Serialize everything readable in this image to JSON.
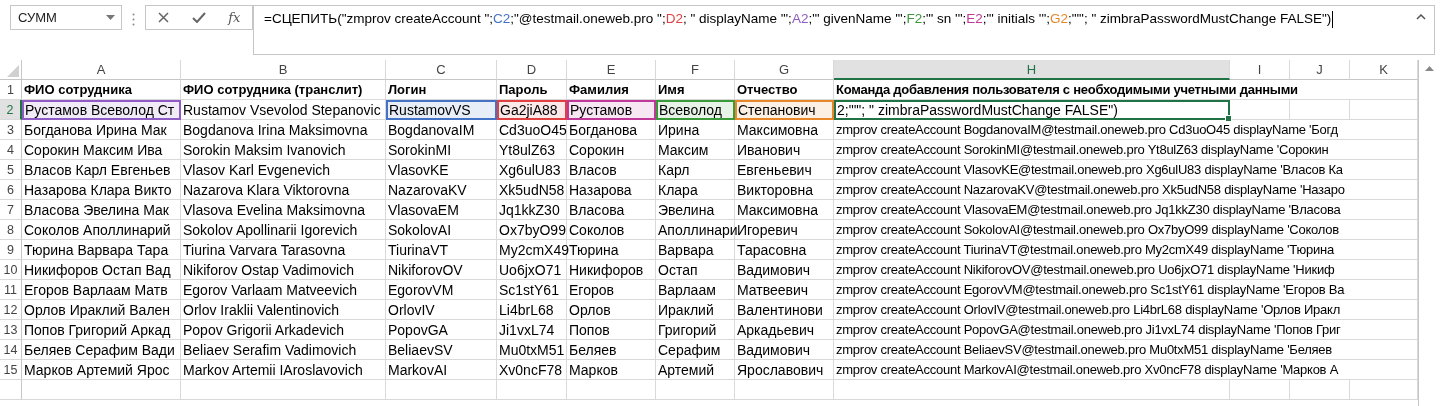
{
  "name_box": {
    "value": "СУММ"
  },
  "formula_bar": {
    "function_label": "fx",
    "segments": [
      {
        "text": "=СЦЕПИТЬ(\"zmprov createAccount \";",
        "color": "#000000"
      },
      {
        "text": "C2",
        "color": "#4472c4"
      },
      {
        "text": ";\"@testmail.oneweb.pro \";",
        "color": "#000000"
      },
      {
        "text": "D2",
        "color": "#e04040"
      },
      {
        "text": "; \" displayName '\";",
        "color": "#000000"
      },
      {
        "text": "A2",
        "color": "#8e5cc4"
      },
      {
        "text": ";\"' givenName '\";",
        "color": "#000000"
      },
      {
        "text": "F2",
        "color": "#3a9a3a"
      },
      {
        "text": ";\"' sn '\";",
        "color": "#000000"
      },
      {
        "text": "E2",
        "color": "#c0399a"
      },
      {
        "text": ";\"' initials '\";",
        "color": "#000000"
      },
      {
        "text": "G2",
        "color": "#e8862a"
      },
      {
        "text": ";\"'\"; \" zimbraPasswordMustChange FALSE\")",
        "color": "#000000"
      }
    ]
  },
  "columns": [
    {
      "letter": "A",
      "selected": false
    },
    {
      "letter": "B",
      "selected": false
    },
    {
      "letter": "C",
      "selected": false
    },
    {
      "letter": "D",
      "selected": false
    },
    {
      "letter": "E",
      "selected": false
    },
    {
      "letter": "F",
      "selected": false
    },
    {
      "letter": "G",
      "selected": false
    },
    {
      "letter": "H",
      "selected": true
    },
    {
      "letter": "I",
      "selected": false
    },
    {
      "letter": "J",
      "selected": false
    },
    {
      "letter": "K",
      "selected": false
    }
  ],
  "rows": [
    {
      "number": "1",
      "selected": false,
      "kind": "header",
      "cells": [
        "ФИО сотрудника",
        "ФИО сотрудника (транслит)",
        "Логин",
        "Пароль",
        "Фамилия",
        "Имя",
        "Отчество",
        "Команда добавления пользователя с необходимыми учетными данными"
      ]
    },
    {
      "number": "2",
      "selected": true,
      "kind": "edit",
      "cells": [
        {
          "text": "Рустамов Всеволод Ст",
          "color": "#8e5cc4",
          "active": false
        },
        {
          "text": "Rustamov Vsevolod Stepanovic",
          "active": false
        },
        {
          "text": "RustamovVS",
          "color": "#4472c4",
          "active": false
        },
        {
          "text": "Ga2jiA88",
          "color": "#e04040",
          "active": false
        },
        {
          "text": "Рустамов",
          "color": "#c0399a",
          "active": false
        },
        {
          "text": "Всеволод",
          "color": "#3a9a3a",
          "active": false
        },
        {
          "text": "Степанович",
          "color": "#e8862a",
          "active": false
        },
        {
          "text": "2;\"'\"; \" zimbraPasswordMustChange FALSE\")",
          "active": true
        }
      ]
    },
    {
      "number": "3",
      "selected": false,
      "kind": "data",
      "cells": [
        "Богданова Ирина Мак",
        "Bogdanova Irina Maksimovna",
        "BogdanovaIM",
        "Cd3uoO45",
        "Богданова",
        "Ирина",
        "Максимовна",
        "zmprov createAccount BogdanovaIM@testmail.oneweb.pro Cd3uoO45 displayName 'Богд"
      ]
    },
    {
      "number": "4",
      "selected": false,
      "kind": "data",
      "cells": [
        "Сорокин Максим Ива",
        "Sorokin Maksim Ivanovich",
        "SorokinMI",
        "Yt8ulZ63",
        "Сорокин",
        "Максим",
        "Иванович",
        "zmprov createAccount SorokinMI@testmail.oneweb.pro Yt8ulZ63 displayName 'Сорокин"
      ]
    },
    {
      "number": "5",
      "selected": false,
      "kind": "data",
      "cells": [
        "Власов Карл Евгеньев",
        "Vlasov Karl Evgenevich",
        "VlasovKE",
        "Xg6ulU83",
        "Власов",
        "Карл",
        "Евгеньевич",
        "zmprov createAccount VlasovKE@testmail.oneweb.pro Xg6ulU83 displayName 'Власов Ка"
      ]
    },
    {
      "number": "6",
      "selected": false,
      "kind": "data",
      "cells": [
        "Назарова Клара Викто",
        "Nazarova Klara Viktorovna",
        "NazarovaKV",
        "Xk5udN58",
        "Назарова",
        "Клара",
        "Викторовна",
        "zmprov createAccount NazarovaKV@testmail.oneweb.pro Xk5udN58 displayName 'Назаро"
      ]
    },
    {
      "number": "7",
      "selected": false,
      "kind": "data",
      "cells": [
        "Власова Эвелина Мак",
        "Vlasova Evelina Maksimovna",
        "VlasovaEM",
        "Jq1kkZ30",
        "Власова",
        "Эвелина",
        "Максимовна",
        "zmprov createAccount VlasovaEM@testmail.oneweb.pro Jq1kkZ30 displayName 'Власова"
      ]
    },
    {
      "number": "8",
      "selected": false,
      "kind": "data",
      "cells": [
        "Соколов Аполлинарий",
        "Sokolov Apollinarii Igorevich",
        "SokolovAI",
        "Ox7byO99",
        "Соколов",
        "Аполлинари",
        "Игоревич",
        "zmprov createAccount SokolovAI@testmail.oneweb.pro Ox7byO99 displayName 'Соколов"
      ]
    },
    {
      "number": "9",
      "selected": false,
      "kind": "data",
      "cells": [
        "Тюрина Варвара Тара",
        "Tiurina Varvara Tarasovna",
        "TiurinaVT",
        "My2cmX49",
        "Тюрина",
        "Варвара",
        "Тарасовна",
        "zmprov createAccount TiurinaVT@testmail.oneweb.pro My2cmX49 displayName 'Тюрина"
      ]
    },
    {
      "number": "10",
      "selected": false,
      "kind": "data",
      "cells": [
        "Никифоров Остап Вад",
        "Nikiforov Ostap Vadimovich",
        "NikiforovOV",
        "Uo6jxO71",
        "Никифоров",
        "Остап",
        "Вадимович",
        "zmprov createAccount NikiforovOV@testmail.oneweb.pro Uo6jxO71 displayName 'Никиф"
      ]
    },
    {
      "number": "11",
      "selected": false,
      "kind": "data",
      "cells": [
        "Егоров Варлаам Матв",
        "Egorov Varlaam Matveevich",
        "EgorovVM",
        "Sc1stY61",
        "Егоров",
        "Варлаам",
        "Матвеевич",
        "zmprov createAccount EgorovVM@testmail.oneweb.pro Sc1stY61 displayName 'Егоров Ва"
      ]
    },
    {
      "number": "12",
      "selected": false,
      "kind": "data",
      "cells": [
        "Орлов Ираклий Вален",
        "Orlov Iraklii Valentinovich",
        "OrlovIV",
        "Li4brL68",
        "Орлов",
        "Ираклий",
        "Валентинови",
        "zmprov createAccount OrlovIV@testmail.oneweb.pro Li4brL68 displayName 'Орлов Иракл"
      ]
    },
    {
      "number": "13",
      "selected": false,
      "kind": "data",
      "cells": [
        "Попов Григорий Аркад",
        "Popov Grigorii Arkadevich",
        "PopovGA",
        "Ji1vxL74",
        "Попов",
        "Григорий",
        "Аркадьевич",
        "zmprov createAccount PopovGA@testmail.oneweb.pro Ji1vxL74 displayName 'Попов Григ"
      ]
    },
    {
      "number": "14",
      "selected": false,
      "kind": "data",
      "cells": [
        "Беляев Серафим Вади",
        "Beliaev Serafim Vadimovich",
        "BeliaevSV",
        "Mu0txM51",
        "Беляев",
        "Серафим",
        "Вадимович",
        "zmprov createAccount BeliaevSV@testmail.oneweb.pro Mu0txM51 displayName 'Беляев"
      ]
    },
    {
      "number": "15",
      "selected": false,
      "kind": "data",
      "cells": [
        "Марков Артемий Ярос",
        "Markov Artemii IAroslavovich",
        "MarkovAI",
        "Xv0ncF78",
        "Марков",
        "Артемий",
        "Ярославович",
        "zmprov createAccount MarkovAI@testmail.oneweb.pro Xv0ncF78 displayName 'Марков А"
      ]
    }
  ]
}
